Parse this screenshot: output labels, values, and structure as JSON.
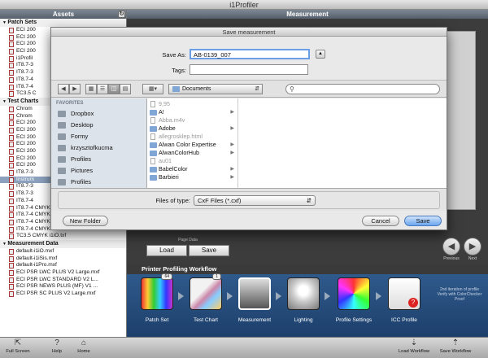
{
  "app": {
    "title": "i1Profiler"
  },
  "left_panel": {
    "header": "Assets",
    "refresh_icon": "refresh-icon",
    "groups": [
      {
        "name": "Patch Sets",
        "items": [
          "ECI 200",
          "ECI 200",
          "ECI 200",
          "ECI 200",
          "i1Profil",
          "IT8.7-3",
          "IT8.7-3",
          "IT8.7-4",
          "IT8.7-4",
          "TC3.5 C"
        ]
      },
      {
        "name": "Test Charts",
        "items": [
          "Chrom",
          "Chrom",
          "ECI 200",
          "ECI 200",
          "ECI 200",
          "ECI 200",
          "ECI 200",
          "ECI 200",
          "ECI 200",
          "IT8.7-3",
          "Instrum",
          "IT8.7-3",
          "IT8.7-3",
          "IT8.7-4",
          "IT8.7-4 CMYK random 1P i1iSis.txf",
          "IT8.7-4 CMYK visual 1P i1iO.txf",
          "IT8.7-4 CMYK visual 1P i1iSis XL...",
          "IT8.7-4 CMYK visual 1P i1iSis.txf",
          "TC3.5 CMYK i1iO.txf"
        ]
      },
      {
        "name": "Measurement Data",
        "items": [
          "default-i1iO.mxf",
          "default-i1iSis.mxf",
          "default-i1Pro.mxf",
          "ECI PSR LWC PLUS V2 Large.mxf",
          "ECI PSR LWC STANDARD V2 L...",
          "ECI PSR NEWS PLUS (MF) V1 ...",
          "ECI PSR SC PLUS V2 Large.mxf"
        ]
      }
    ],
    "selected_item": "Instrum"
  },
  "main": {
    "header": "Measurement",
    "page_data": {
      "label": "Page Data",
      "load": "Load",
      "save": "Save"
    },
    "nav": {
      "previous": "Previous",
      "next": "Next"
    }
  },
  "workflow": {
    "title": "Printer Profiling Workflow",
    "steps": [
      {
        "label": "Patch Set",
        "badge": "64"
      },
      {
        "label": "Test Chart",
        "badge": "1"
      },
      {
        "label": "Measurement",
        "badge": ""
      },
      {
        "label": "Lighting",
        "badge": ""
      },
      {
        "label": "Profile Settings",
        "badge": ""
      },
      {
        "label": "ICC Profile",
        "badge": ""
      }
    ],
    "note": "2nd iteration of profile Verify with ColorChecker Proof"
  },
  "bottombar": {
    "full_screen": "Full Screen",
    "help": "Help",
    "home": "Home",
    "load_workflow": "Load Workflow",
    "save_workflow": "Save Workflow"
  },
  "dialog": {
    "title": "Save measurement",
    "save_as_label": "Save As:",
    "save_as_value": "AB-0139_007",
    "tags_label": "Tags:",
    "tags_value": "",
    "location": "Documents",
    "search_placeholder": "",
    "sidebar": {
      "section": "FAVORITES",
      "items": [
        "Dropbox",
        "Desktop",
        "Formy",
        "krzysztofkucma",
        "Profiles",
        "Pictures",
        "Profiles"
      ]
    },
    "files": [
      {
        "name": "9,95",
        "kind": "doc",
        "dim": true,
        "folder": false
      },
      {
        "name": "A!",
        "kind": "folder",
        "dim": false,
        "folder": true
      },
      {
        "name": "Abba.m4v",
        "kind": "doc",
        "dim": true,
        "folder": false
      },
      {
        "name": "Adobe",
        "kind": "folder",
        "dim": false,
        "folder": true
      },
      {
        "name": "allegrosklep.html",
        "kind": "doc",
        "dim": true,
        "folder": false
      },
      {
        "name": "Alwan Color Expertise",
        "kind": "folder",
        "dim": false,
        "folder": true
      },
      {
        "name": "AlwanColorHub",
        "kind": "folder",
        "dim": false,
        "folder": true
      },
      {
        "name": "au01",
        "kind": "doc",
        "dim": true,
        "folder": false
      },
      {
        "name": "BabelColor",
        "kind": "folder",
        "dim": false,
        "folder": true
      },
      {
        "name": "Barbieri",
        "kind": "folder",
        "dim": false,
        "folder": true
      }
    ],
    "files_of_type_label": "Files of type:",
    "files_of_type_value": "CxF Files (*.cxf)",
    "new_folder": "New Folder",
    "cancel": "Cancel",
    "save": "Save"
  }
}
